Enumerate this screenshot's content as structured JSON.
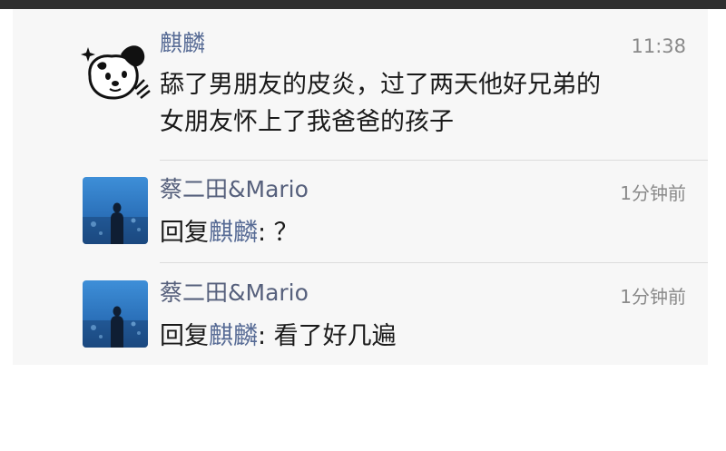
{
  "comments": [
    {
      "name": "麒麟",
      "time": "11:38",
      "lines": [
        "舔了男朋友的皮炎，过了两天他好兄弟的",
        "女朋友怀上了我爸爸的孩子"
      ],
      "avatar": "cartoon-dog-avatar"
    },
    {
      "name": "蔡二田&Mario",
      "time": "1分钟前",
      "reply_prefix": "回复",
      "reply_target": "麒麟",
      "reply_text": ": ？",
      "avatar": "underwater-photo-avatar"
    },
    {
      "name": "蔡二田&Mario",
      "time": "1分钟前",
      "reply_prefix": "回复",
      "reply_target": "麒麟",
      "reply_text": ": 看了好几遍",
      "avatar": "underwater-photo-avatar"
    }
  ],
  "colors": {
    "name": "#576b95",
    "text": "#1a1a1a",
    "time": "#8a8a8a",
    "background": "#f7f7f7"
  }
}
